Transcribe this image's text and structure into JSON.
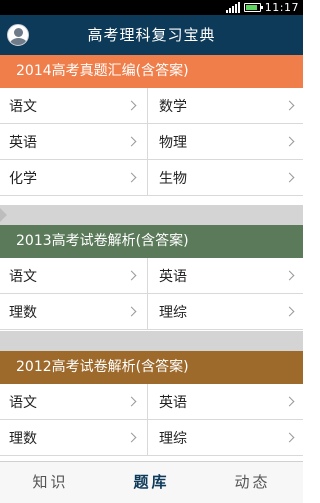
{
  "status_bar": {
    "time": "11:17",
    "battery_level": 0.9,
    "icons": [
      "signal-icon",
      "battery-icon"
    ]
  },
  "header": {
    "title": "高考理科复习宝典",
    "avatar_icon": "user-avatar-icon"
  },
  "sections": [
    {
      "title": "2014高考真题汇编(含答案)",
      "color": "#f07e4a",
      "items": [
        "语文",
        "数学",
        "英语",
        "物理",
        "化学",
        "生物"
      ]
    },
    {
      "title": "2013高考试卷解析(含答案)",
      "color": "#5b7a5a",
      "items": [
        "语文",
        "英语",
        "理数",
        "理综"
      ]
    },
    {
      "title": "2012高考试卷解析(含答案)",
      "color": "#9e6a2c",
      "items": [
        "语文",
        "英语",
        "理数",
        "理综"
      ]
    }
  ],
  "tabs": [
    {
      "label": "知识",
      "active": false
    },
    {
      "label": "题库",
      "active": true
    },
    {
      "label": "动态",
      "active": false
    }
  ],
  "colors": {
    "header_bg": "#0e3a5a",
    "divider_bg": "#d4d4d4",
    "tab_active": "#0e3a5a"
  }
}
